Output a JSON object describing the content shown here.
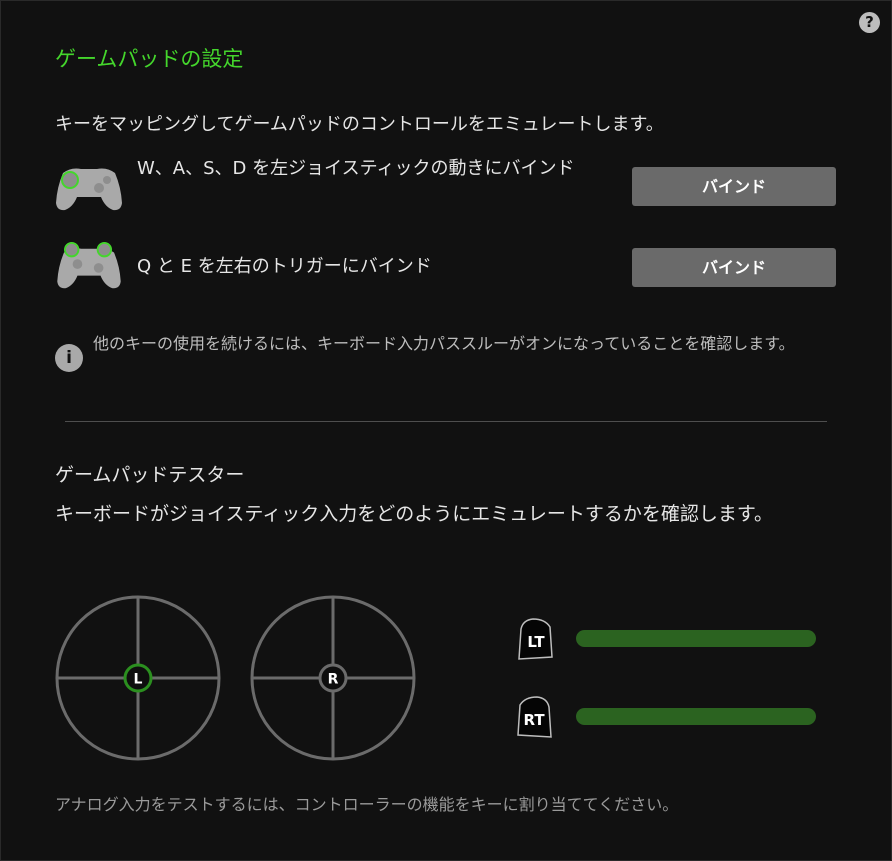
{
  "header": {
    "title": "ゲームパッドの設定",
    "help_label": "?"
  },
  "mapping": {
    "description": "キーをマッピングしてゲームパッドのコントロールをエミュレートします。",
    "rows": [
      {
        "label": "W、A、S、D を左ジョイスティックの動きにバインド",
        "button_label": "バインド",
        "icon": "gamepad-left-stick-icon"
      },
      {
        "label": "Q と E を左右のトリガーにバインド",
        "button_label": "バインド",
        "icon": "gamepad-triggers-icon"
      }
    ],
    "info_text": "他のキーの使用を続けるには、キーボード入力パススルーがオンになっていることを確認します。",
    "info_icon_label": "i"
  },
  "tester": {
    "title": "ゲームパッドテスター",
    "description": "キーボードがジョイスティック入力をどのようにエミュレートするかを確認します。",
    "left_stick_label": "L",
    "right_stick_label": "R",
    "triggers": [
      {
        "label": "LT",
        "value": 1.0
      },
      {
        "label": "RT",
        "value": 1.0
      }
    ],
    "footer_note": "アナログ入力をテストするには、コントローラーの機能をキーに割り当ててください。"
  },
  "colors": {
    "accent": "#44d62c",
    "bar_fill": "#2b6320",
    "button_bg": "#6a6a6a",
    "background": "#111111"
  }
}
